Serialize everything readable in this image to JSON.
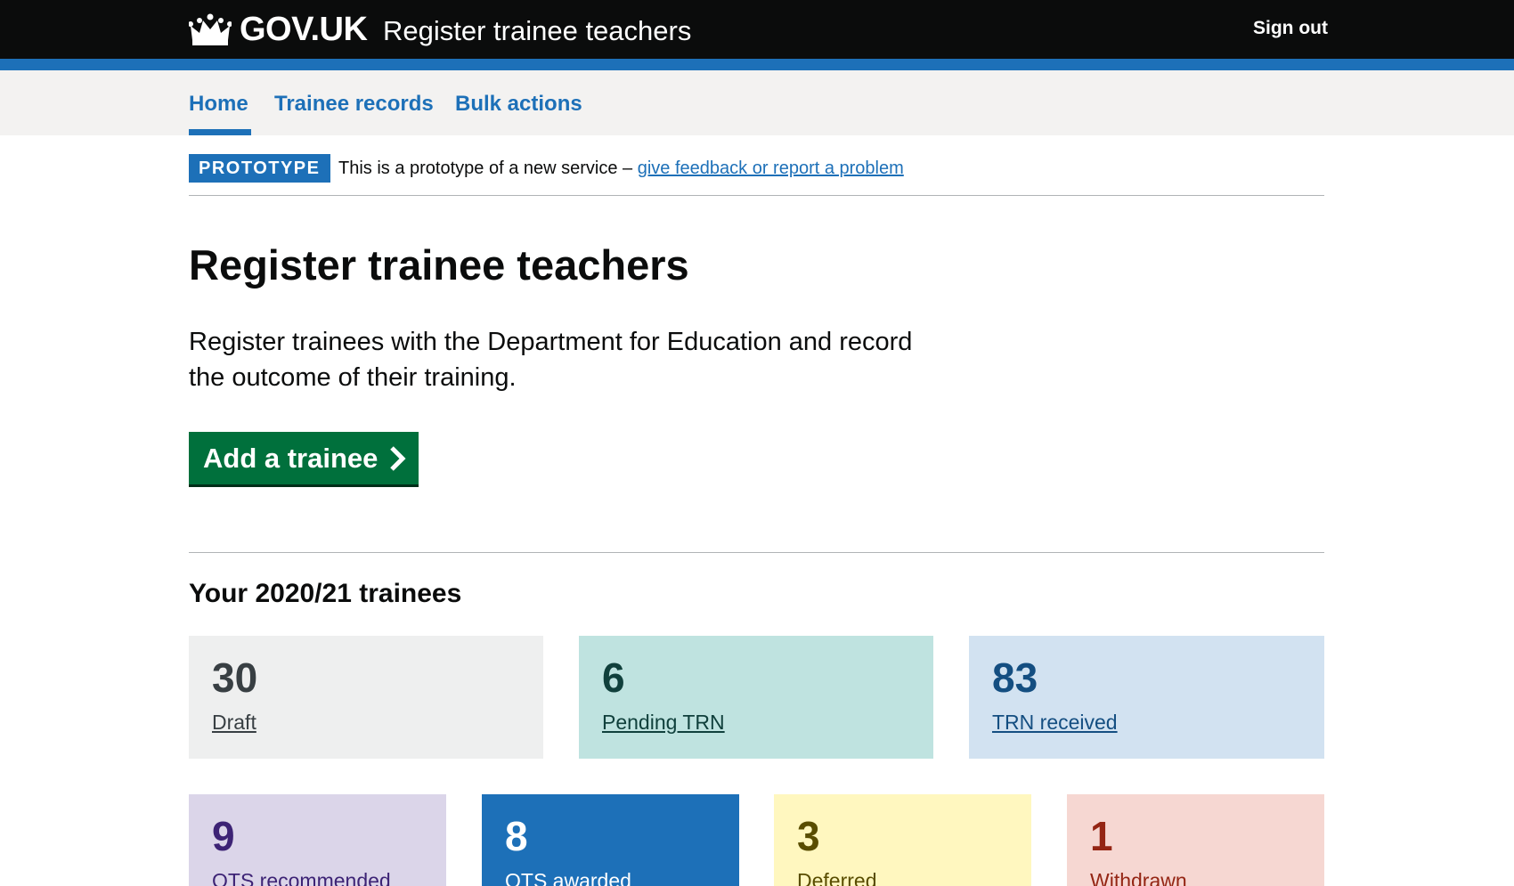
{
  "header": {
    "logo_text": "GOV.UK",
    "service_name": "Register trainee teachers",
    "sign_out": "Sign out"
  },
  "nav": {
    "items": [
      {
        "label": "Home",
        "active": true
      },
      {
        "label": "Trainee records",
        "active": false
      },
      {
        "label": "Bulk actions",
        "active": false
      }
    ]
  },
  "phase_banner": {
    "tag": "PROTOTYPE",
    "text": "This is a prototype of a new service – ",
    "link": "give feedback or report a problem"
  },
  "main": {
    "title": "Register trainee teachers",
    "lead": "Register trainees with the Department for Education and record the outcome of their training.",
    "start_button": "Add a trainee",
    "section_title": "Your 2020/21 trainees"
  },
  "cards": [
    {
      "count": "30",
      "label": "Draft",
      "bg": "#eeefef",
      "fg": "#383f43"
    },
    {
      "count": "6",
      "label": "Pending TRN",
      "bg": "#bfe3e0",
      "fg": "#10403c"
    },
    {
      "count": "83",
      "label": "TRN received",
      "bg": "#d2e2f1",
      "fg": "#144e81"
    },
    {
      "count": "9",
      "label": "QTS recommended",
      "bg": "#dbd5e9",
      "fg": "#3d2375"
    },
    {
      "count": "8",
      "label": "QTS awarded",
      "bg": "#1d70b8",
      "fg": "#ffffff"
    },
    {
      "count": "3",
      "label": "Deferred",
      "bg": "#fff7bf",
      "fg": "#594d00"
    },
    {
      "count": "1",
      "label": "Withdrawn",
      "bg": "#f6d7d2",
      "fg": "#942514"
    }
  ],
  "colors": {
    "header_bg": "#0b0c0c",
    "brand_blue": "#1d70b8",
    "start_green": "#00703c",
    "nav_bg": "#f3f2f1"
  },
  "icons": {
    "logo": "crown-icon",
    "start": "chevron-right-icon"
  }
}
